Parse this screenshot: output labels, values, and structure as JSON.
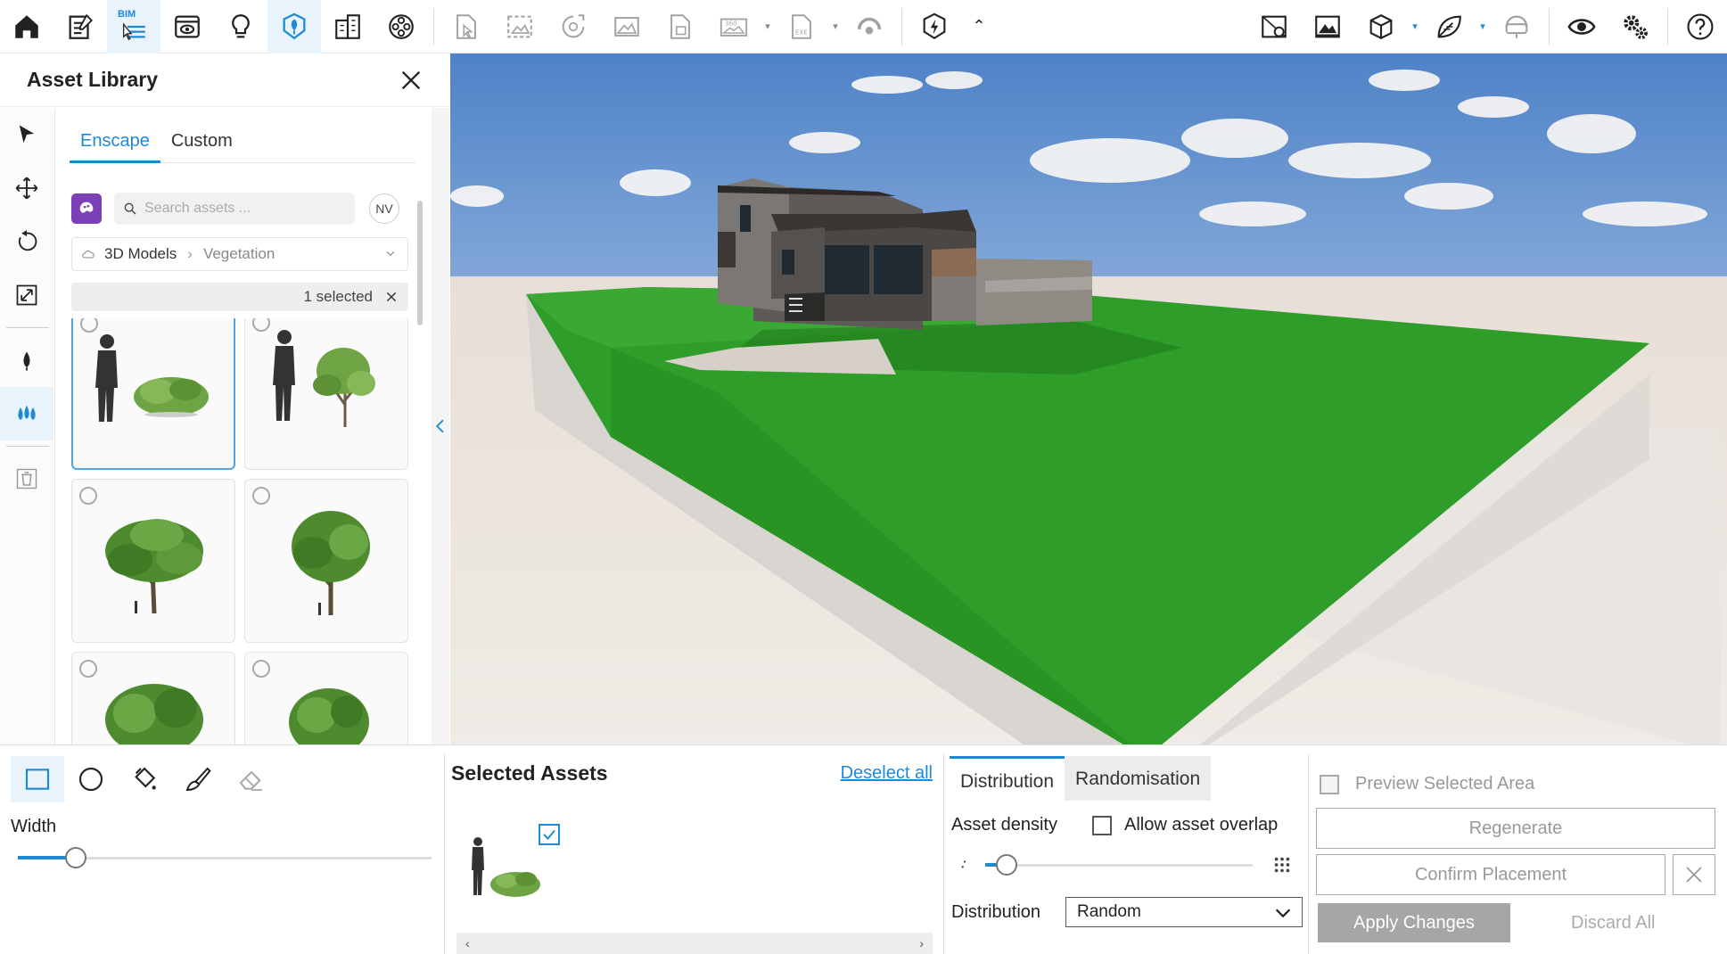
{
  "toolbar": {
    "bim_tag": "BIM",
    "buttons": [
      "home-icon",
      "project-icon",
      "bim-icon",
      "view-icon",
      "idea-icon",
      "asset-library-icon",
      "building-icon",
      "material-icon",
      "export-icon",
      "screenshot-icon",
      "panorama-icon",
      "image-icon",
      "document-icon",
      "360-icon",
      "exe-icon",
      "vr-icon",
      "power-icon",
      "map-icon",
      "gallery-icon",
      "cube-icon",
      "leaf-icon",
      "headset-icon",
      "eye-icon",
      "settings-icon",
      "help-icon"
    ]
  },
  "library": {
    "title": "Asset Library",
    "tabs": [
      {
        "label": "Enscape"
      },
      {
        "label": "Custom"
      }
    ],
    "search": {
      "placeholder": "Search assets ...",
      "avatar": "NV"
    },
    "breadcrumb": {
      "root": "3D Models",
      "category": "Vegetation"
    },
    "selected_count": "1 selected"
  },
  "bottom": {
    "width_label": "Width",
    "width_value": 0.14,
    "selected_assets_title": "Selected Assets",
    "deselect_all": "Deselect all",
    "tabs": {
      "distribution": "Distribution",
      "randomisation": "Randomisation"
    },
    "asset_density_label": "Asset density",
    "asset_density_value": 0.08,
    "allow_overlap_label": "Allow asset overlap",
    "distribution_label": "Distribution",
    "distribution_value": "Random",
    "preview_label": "Preview Selected Area",
    "regenerate": "Regenerate",
    "confirm": "Confirm Placement",
    "apply": "Apply Changes",
    "discard": "Discard All"
  },
  "colors": {
    "accent": "#1e8ad6",
    "grass": "#2f9d2a",
    "sky": "#6f9fd8"
  }
}
